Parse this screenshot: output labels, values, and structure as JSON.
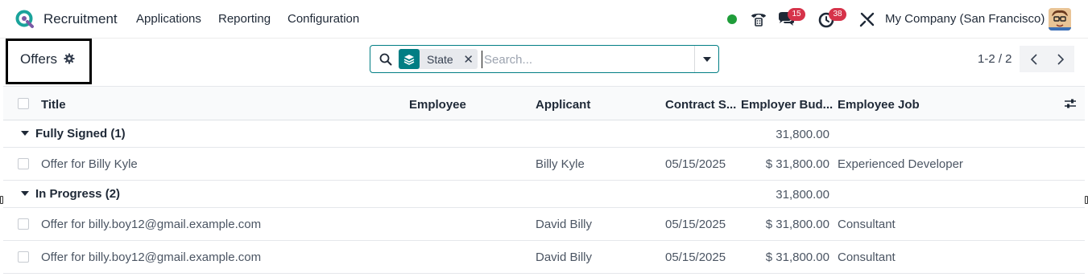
{
  "app": {
    "name": "Recruitment",
    "nav": [
      "Applications",
      "Reporting",
      "Configuration"
    ]
  },
  "systray": {
    "messages_count": "15",
    "activities_count": "38",
    "company": "My Company (San Francisco)"
  },
  "control": {
    "title": "Offers",
    "search": {
      "facet_label": "State",
      "placeholder": "Search..."
    },
    "pager": "1-2 / 2"
  },
  "table": {
    "columns": [
      "Title",
      "Employee",
      "Applicant",
      "Contract S...",
      "Employer Bud...",
      "Employee Job"
    ],
    "groups": [
      {
        "label": "Fully Signed (1)",
        "total": "31,800.00",
        "rows": [
          {
            "title": "Offer for Billy Kyle",
            "employee": "",
            "applicant": "Billy Kyle",
            "contract_start": "05/15/2025",
            "budget": "$ 31,800.00",
            "job": "Experienced Developer"
          }
        ]
      },
      {
        "label": "In Progress (2)",
        "total": "31,800.00",
        "rows": [
          {
            "title": "Offer for billy.boy12@gmail.example.com",
            "employee": "",
            "applicant": "David Billy",
            "contract_start": "05/15/2025",
            "budget": "$ 31,800.00",
            "job": "Consultant"
          },
          {
            "title": "Offer for billy.boy12@gmail.example.com",
            "employee": "",
            "applicant": "David Billy",
            "contract_start": "05/15/2025",
            "budget": "$ 31,800.00",
            "job": "Consultant"
          }
        ]
      }
    ]
  },
  "colors": {
    "accent": "#017e84",
    "badge": "#d6334a",
    "online": "#1f9d3a"
  }
}
